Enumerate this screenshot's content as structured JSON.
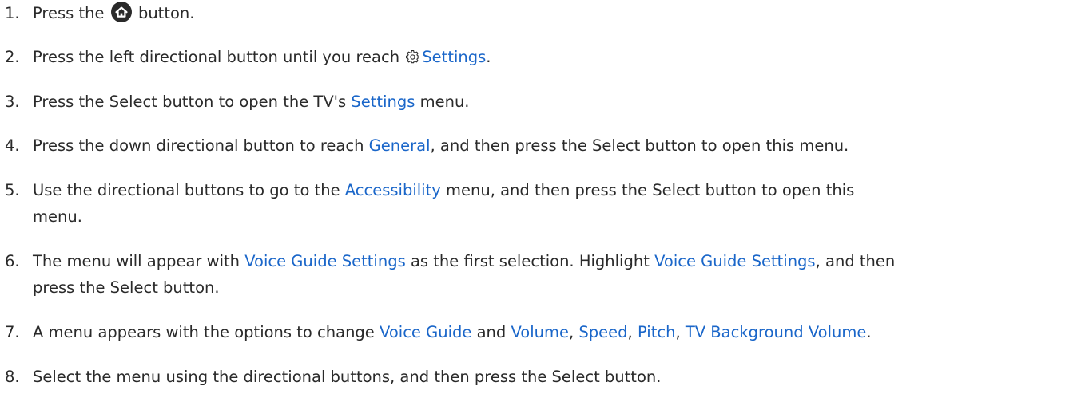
{
  "steps": [
    {
      "num": "1.",
      "parts": [
        "Press the",
        "button."
      ]
    },
    {
      "num": "2.",
      "parts": [
        "Press the left directional button until you reach",
        "Settings",
        "."
      ]
    },
    {
      "num": "3.",
      "parts": [
        "Press the Select button to open the TV's",
        "Settings",
        "menu."
      ]
    },
    {
      "num": "4.",
      "parts": [
        "Press the down directional button to reach",
        "General",
        ", and then press the Select button to open this menu."
      ]
    },
    {
      "num": "5.",
      "parts": [
        "Use the directional buttons to go to the",
        "Accessibility",
        "menu, and then press the Select button to open this",
        "menu."
      ]
    },
    {
      "num": "6.",
      "parts": [
        "The menu will appear with",
        "Voice Guide Settings",
        "as the first selection. Highlight",
        "Voice Guide Settings",
        ", and then",
        "press the Select button."
      ]
    },
    {
      "num": "7.",
      "parts": [
        "A menu appears with the options to change",
        "Voice Guide",
        "and",
        "Volume",
        ",",
        "Speed",
        ",",
        "Pitch",
        ",",
        "TV Background Volume",
        "."
      ]
    },
    {
      "num": "8.",
      "parts": [
        "Select the menu using the directional buttons, and then press the Select button."
      ]
    }
  ],
  "colors": {
    "text": "#2a2a2a",
    "link": "#1a66c9"
  },
  "icons": {
    "home": "home-icon",
    "settings": "gear-icon"
  }
}
